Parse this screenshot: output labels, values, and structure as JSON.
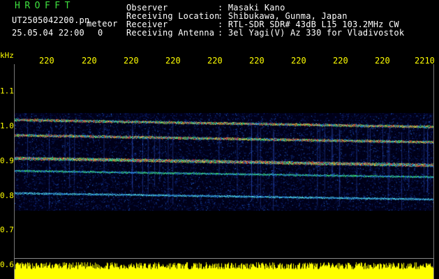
{
  "header": {
    "app_title": "HROFFT",
    "filename": "UT2505042200.pn",
    "mode": "meteor",
    "datetime": "25.05.04 22:00",
    "count": "0",
    "observer_label": "Observer",
    "observer_value": ": Masaki Kano",
    "location_label": "Receiving Location",
    "location_value": ": Shibukawa, Gunma, Japan",
    "receiver_label": "Receiver",
    "receiver_value": ": RTL-SDR SDR# 43dB L15 103.2MHz CW",
    "antenna_label": "Receiving Antenna",
    "antenna_value": ": 3el Yagi(V) Az 330 for Vladivostok"
  },
  "axes": {
    "y_unit": "kHz",
    "x_ticks": [
      "220",
      "220",
      "220",
      "220",
      "220",
      "220",
      "220",
      "220",
      "220",
      "2210"
    ],
    "y_ticks": [
      "1.1",
      "1.0",
      "0.9",
      "0.8",
      "0.7",
      "0.6"
    ]
  },
  "colors": {
    "label_yellow": "#ffff00",
    "title_green": "#3fe03f",
    "background": "#000000"
  }
}
